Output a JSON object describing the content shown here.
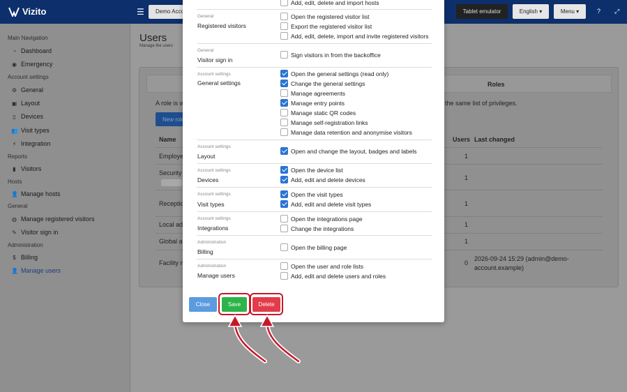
{
  "topbar": {
    "brand": "Vizito",
    "tenant": "Demo Account",
    "tablet_emulator": "Tablet emulator",
    "language": "English",
    "menu": "Menu"
  },
  "sidebar": {
    "sections": [
      {
        "title": "Main Navigation",
        "items": [
          {
            "icon": "dashboard-icon",
            "label": "Dashboard"
          },
          {
            "icon": "emergency-icon",
            "label": "Emergency"
          }
        ]
      },
      {
        "title": "Account settings",
        "items": [
          {
            "icon": "gear-icon",
            "label": "General"
          },
          {
            "icon": "layout-icon",
            "label": "Layout"
          },
          {
            "icon": "tablet-icon",
            "label": "Devices"
          },
          {
            "icon": "users-icon",
            "label": "Visit types"
          },
          {
            "icon": "plug-icon",
            "label": "Integration"
          }
        ]
      },
      {
        "title": "Reports",
        "items": [
          {
            "icon": "bar-chart-icon",
            "label": "Visitors"
          }
        ]
      },
      {
        "title": "Hosts",
        "items": [
          {
            "icon": "person-icon",
            "label": "Manage hosts"
          }
        ]
      },
      {
        "title": "General",
        "items": [
          {
            "icon": "user-circle-icon",
            "label": "Manage registered visitors"
          },
          {
            "icon": "pencil-icon",
            "label": "Visitor sign in"
          }
        ]
      },
      {
        "title": "Administration",
        "items": [
          {
            "icon": "dollar-icon",
            "label": "Billing"
          },
          {
            "icon": "user-gear-icon",
            "label": "Manage users"
          }
        ]
      }
    ]
  },
  "main": {
    "title": "Users",
    "subtitle": "Manage the users",
    "roles_tab": "Roles",
    "role_intro": "A role is wh",
    "role_intro_end": "the same list of privileges.",
    "new_role": "New role",
    "col_name": "Name",
    "col_users": "Users",
    "col_last_changed": "Last changed",
    "rows": [
      {
        "name": "Employe",
        "users": "1",
        "last_changed": ""
      },
      {
        "name": "Security p",
        "users": "1",
        "last_changed": ""
      },
      {
        "name": "Reception",
        "users": "1",
        "last_changed": ""
      },
      {
        "name": "Local adm",
        "users": "1",
        "last_changed": ""
      },
      {
        "name": "Global ad",
        "users": "1",
        "last_changed": ""
      },
      {
        "name": "Facility m",
        "users": "0",
        "last_changed": "2026-09-24 15:29 (admin@demo-account.example)"
      }
    ]
  },
  "modal": {
    "groups": [
      {
        "category": "",
        "name": "",
        "perms": [
          {
            "label": "Add, edit, delete and import hosts",
            "checked": false
          }
        ]
      },
      {
        "category": "General",
        "name": "Registered visitors",
        "perms": [
          {
            "label": "Open the registered visitor list",
            "checked": false
          },
          {
            "label": "Export the registered visitor list",
            "checked": false
          },
          {
            "label": "Add, edit, delete, import and invite registered visitors",
            "checked": false
          }
        ]
      },
      {
        "category": "General",
        "name": "Visitor sign in",
        "perms": [
          {
            "label": "Sign visitors in from the backoffice",
            "checked": false
          }
        ]
      },
      {
        "category": "Account settings",
        "name": "General settings",
        "perms": [
          {
            "label": "Open the general settings (read only)",
            "checked": true
          },
          {
            "label": "Change the general settings",
            "checked": true
          },
          {
            "label": "Manage agreements",
            "checked": false
          },
          {
            "label": "Manage entry points",
            "checked": true
          },
          {
            "label": "Manage static QR codes",
            "checked": false
          },
          {
            "label": "Manage self-registration links",
            "checked": false
          },
          {
            "label": "Manage data retention and anonymise visitors",
            "checked": false
          }
        ]
      },
      {
        "category": "Account settings",
        "name": "Layout",
        "perms": [
          {
            "label": "Open and change the layout, badges and labels",
            "checked": true
          }
        ]
      },
      {
        "category": "Account settings",
        "name": "Devices",
        "perms": [
          {
            "label": "Open the device list",
            "checked": true
          },
          {
            "label": "Add, edit and delete devices",
            "checked": true
          }
        ]
      },
      {
        "category": "Account settings",
        "name": "Visit types",
        "perms": [
          {
            "label": "Open the visit types",
            "checked": true
          },
          {
            "label": "Add, edit and delete visit types",
            "checked": true
          }
        ]
      },
      {
        "category": "Account settings",
        "name": "Integrations",
        "perms": [
          {
            "label": "Open the integrations page",
            "checked": false
          },
          {
            "label": "Change the integrations",
            "checked": false
          }
        ]
      },
      {
        "category": "Administration",
        "name": "Billing",
        "perms": [
          {
            "label": "Open the billing page",
            "checked": false
          }
        ]
      },
      {
        "category": "Administration",
        "name": "Manage users",
        "perms": [
          {
            "label": "Open the user and role lists",
            "checked": false
          },
          {
            "label": "Add, edit and delete users and roles",
            "checked": false
          }
        ]
      }
    ],
    "buttons": {
      "close": "Close",
      "save": "Save",
      "delete": "Delete"
    }
  }
}
